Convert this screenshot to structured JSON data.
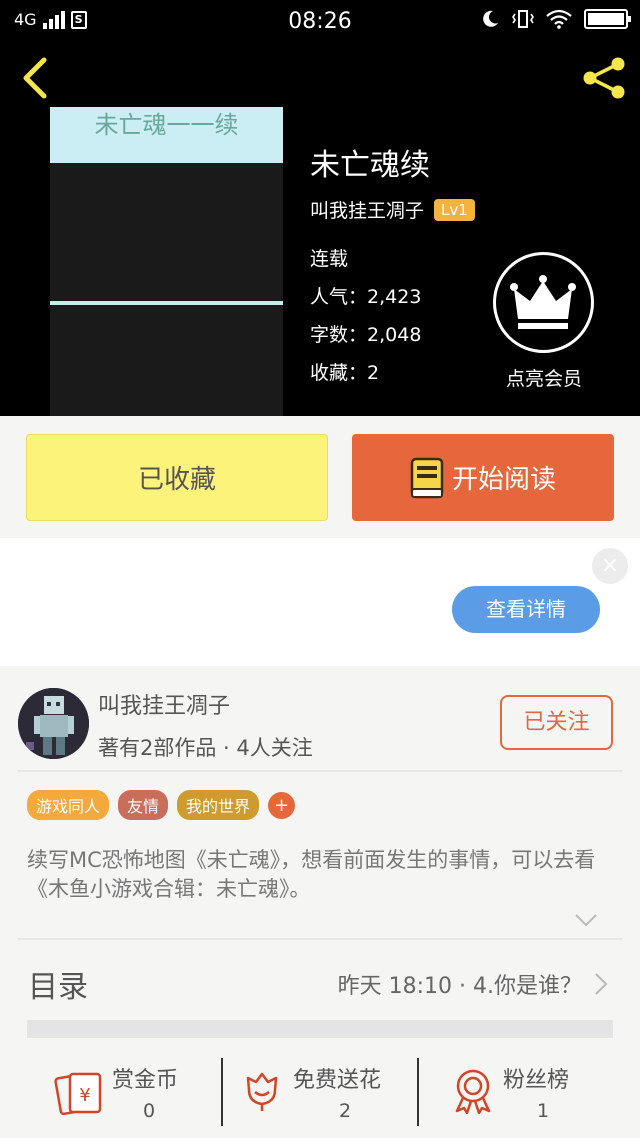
{
  "status_bar": {
    "network": "4G",
    "sim": "S",
    "time": "08:26"
  },
  "book": {
    "title": "未亡魂续",
    "cover_text": "未亡魂一一续",
    "author": "叫我挂王凋子",
    "level": "Lv1",
    "status": "连载",
    "popularity_label": "人气：",
    "popularity": "2,423",
    "words_label": "字数：",
    "words": "2,048",
    "favorites_label": "收藏：",
    "favorites": "2",
    "vip_label": "点亮会员"
  },
  "actions": {
    "collected": "已收藏",
    "read": "开始阅读"
  },
  "ad": {
    "close": "×",
    "details": "查看详情"
  },
  "author_card": {
    "name": "叫我挂王凋子",
    "stats": "著有2部作品 · 4人关注",
    "follow": "已关注"
  },
  "tags": [
    {
      "label": "游戏同人",
      "color": "#f3a93c"
    },
    {
      "label": "友情",
      "color": "#c86e5a"
    },
    {
      "label": "我的世界",
      "color": "#cf9b2e"
    }
  ],
  "tag_add": "+",
  "description": "续写MC恐怖地图《未亡魂》，想看前面发生的事情，可以去看《木鱼小游戏合辑：未亡魂》。",
  "toc": {
    "title": "目录",
    "latest": "昨天 18:10 · 4.你是谁？"
  },
  "bottom": {
    "reward": {
      "label": "赏金币",
      "count": "0"
    },
    "flowers": {
      "label": "免费送花",
      "count": "2"
    },
    "fans": {
      "label": "粉丝榜",
      "count": "1"
    }
  },
  "colors": {
    "accent": "#e7673d",
    "badge": "#f3b33d",
    "collected_bg": "#fbf37a",
    "ad_button": "#5a9de6"
  }
}
